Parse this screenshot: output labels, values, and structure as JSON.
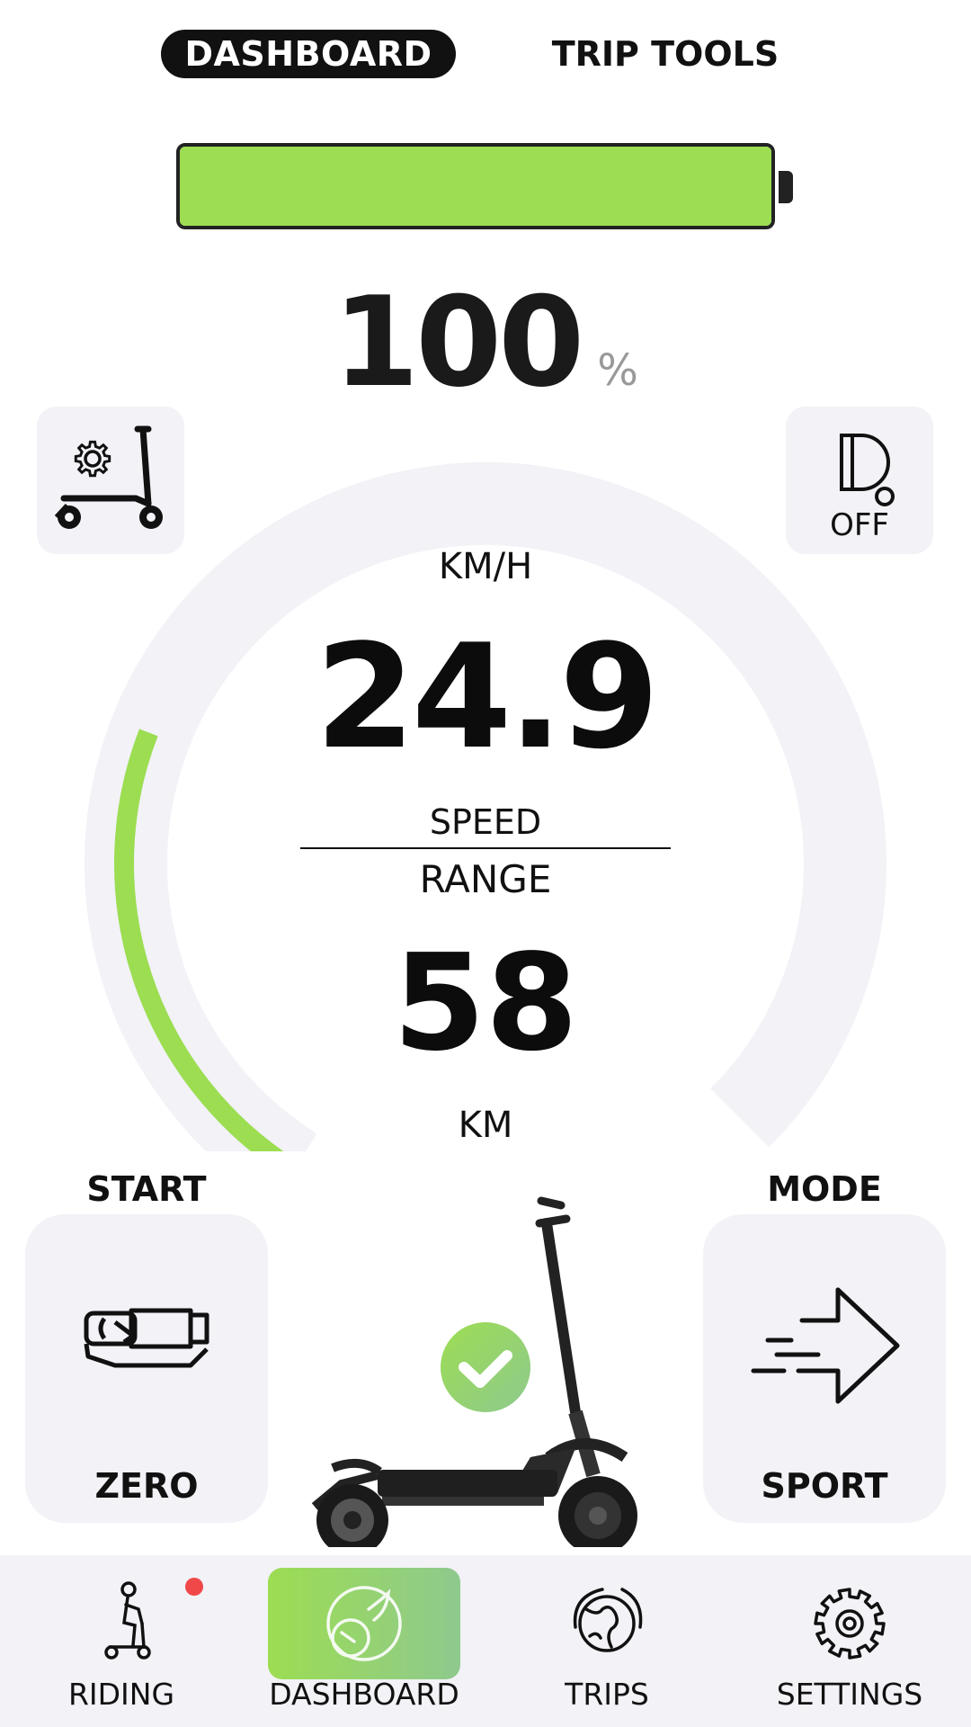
{
  "top_tabs": {
    "dashboard": "DASHBOARD",
    "trip_tools": "TRIP TOOLS"
  },
  "battery": {
    "level": 1.0,
    "percent_value": "100",
    "percent_unit": "%",
    "fill_color": "#9cdd52"
  },
  "light": {
    "status": "OFF",
    "icon": "headlight-icon"
  },
  "scooter_settings": {
    "icon": "scooter-gear-icon"
  },
  "gauge": {
    "speed_unit": "KM/H",
    "speed_value": "24.9",
    "speed_label": "SPEED",
    "range_label": "RANGE",
    "range_value": "58",
    "range_unit": "KM",
    "speed_fill_fraction": 0.28,
    "active_color": "#9cdd52",
    "track_color": "#f2f2f7"
  },
  "start_panel": {
    "title": "START",
    "value": "ZERO",
    "icon": "throttle-icon"
  },
  "mode_panel": {
    "title": "MODE",
    "value": "SPORT",
    "icon": "arrow-right-icon"
  },
  "status": {
    "icon": "checkmark-icon"
  },
  "nav": {
    "items": [
      {
        "label": "RIDING",
        "icon": "rider-icon"
      },
      {
        "label": "DASHBOARD",
        "icon": "speedometer-icon"
      },
      {
        "label": "TRIPS",
        "icon": "globe-icon"
      },
      {
        "label": "SETTINGS",
        "icon": "gear-icon"
      }
    ],
    "active_index": 1
  }
}
